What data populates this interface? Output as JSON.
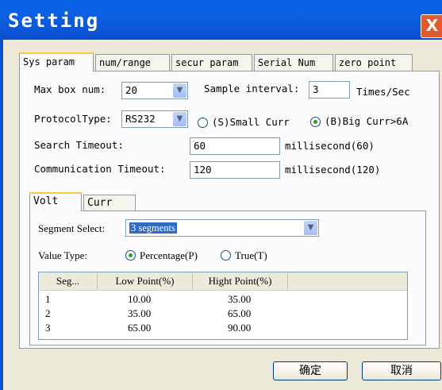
{
  "window": {
    "title": "Setting",
    "close_glyph": "X"
  },
  "tabs": [
    "Sys param",
    "num/range",
    "secur param",
    "Serial Num",
    "zero point"
  ],
  "sys": {
    "max_box_label": "Max box num:",
    "max_box_value": "20",
    "sample_label": "Sample interval:",
    "sample_value": "3",
    "sample_unit": "Times/Sec",
    "protocol_label": "ProtocolType:",
    "protocol_value": "RS232",
    "small_curr": "(S)Small Curr",
    "big_curr": "(B)Big Curr>6A",
    "search_label": "Search Timeout:",
    "search_value": "60",
    "search_unit": "millisecond(60)",
    "comm_label": "Communication Timeout:",
    "comm_value": "120",
    "comm_unit": "millisecond(120)"
  },
  "subtabs": [
    "Volt",
    "Curr"
  ],
  "volt": {
    "segment_label": "Segment Select:",
    "segment_value": "3 segments",
    "value_type_label": "Value Type:",
    "percentage": "Percentage(P)",
    "true": "True(T)",
    "columns": [
      "Seg...",
      "Low Point(%)",
      "Hight Point(%)"
    ],
    "rows": [
      [
        "1",
        "10.00",
        "35.00"
      ],
      [
        "2",
        "35.00",
        "65.00"
      ],
      [
        "3",
        "65.00",
        "90.00"
      ]
    ]
  },
  "buttons": {
    "ok": "确定",
    "cancel": "取消"
  }
}
